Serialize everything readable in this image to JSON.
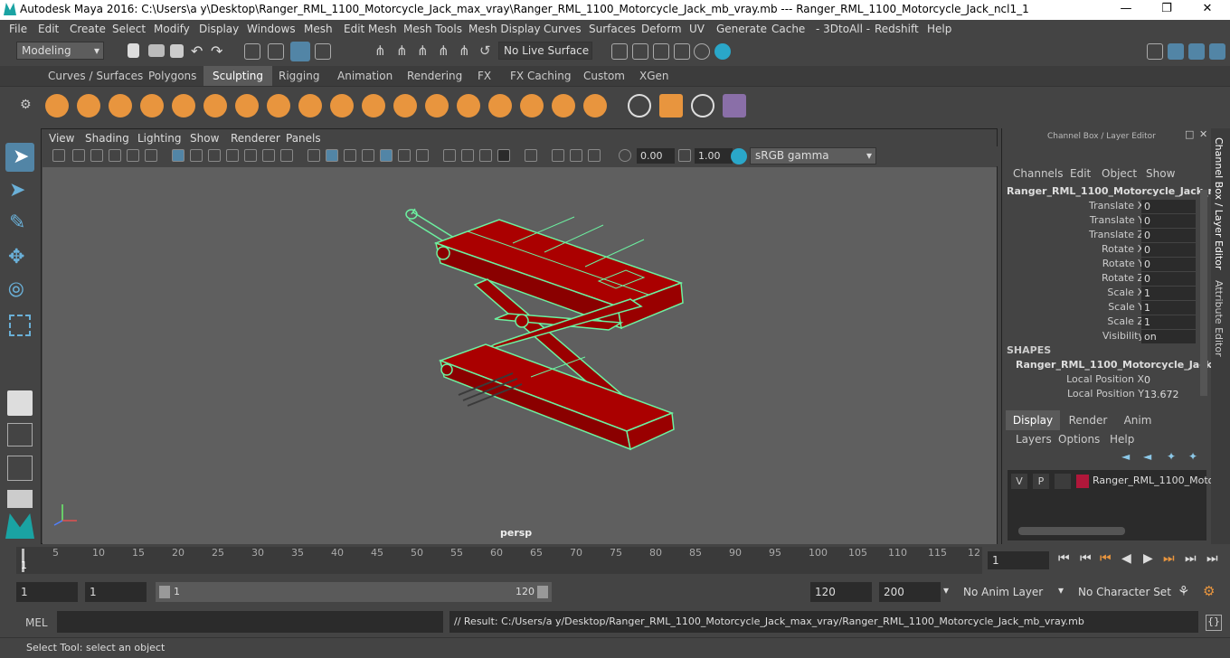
{
  "window": {
    "title": "Autodesk Maya 2016: C:\\Users\\a y\\Desktop\\Ranger_RML_1100_Motorcycle_Jack_max_vray\\Ranger_RML_1100_Motorcycle_Jack_mb_vray.mb   ---   Ranger_RML_1100_Motorcycle_Jack_ncl1_1",
    "minimize": "—",
    "maximize": "❐",
    "close": "✕"
  },
  "menu": [
    "File",
    "Edit",
    "Create",
    "Select",
    "Modify",
    "Display",
    "Windows",
    "Mesh",
    "Edit Mesh",
    "Mesh Tools",
    "Mesh Display",
    "Curves",
    "Surfaces",
    "Deform",
    "UV",
    "Generate",
    "Cache",
    "- 3DtoAll -",
    "Redshift",
    "Help"
  ],
  "statusline": {
    "mode": "Modeling",
    "live_surface": "No Live Surface"
  },
  "shelf_tabs": [
    {
      "label": "Curves / Surfaces",
      "active": false
    },
    {
      "label": "Polygons",
      "active": false
    },
    {
      "label": "Sculpting",
      "active": true
    },
    {
      "label": "Rigging",
      "active": false
    },
    {
      "label": "Animation",
      "active": false
    },
    {
      "label": "Rendering",
      "active": false
    },
    {
      "label": "FX",
      "active": false
    },
    {
      "label": "FX Caching",
      "active": false
    },
    {
      "label": "Custom",
      "active": false
    },
    {
      "label": "XGen",
      "active": false
    }
  ],
  "viewport": {
    "menu": [
      "View",
      "Shading",
      "Lighting",
      "Show",
      "Renderer",
      "Panels"
    ],
    "exposure": "0.00",
    "gamma": "1.00",
    "colorspace": "sRGB gamma",
    "camera_label": "persp"
  },
  "channel_box": {
    "header": "Channel Box / Layer Editor",
    "menu": [
      "Channels",
      "Edit",
      "Object",
      "Show"
    ],
    "object_name": "Ranger_RML_1100_Motorcycle_Jack_n...",
    "channels": [
      {
        "label": "Translate X",
        "value": "0"
      },
      {
        "label": "Translate Y",
        "value": "0"
      },
      {
        "label": "Translate Z",
        "value": "0"
      },
      {
        "label": "Rotate X",
        "value": "0"
      },
      {
        "label": "Rotate Y",
        "value": "0"
      },
      {
        "label": "Rotate Z",
        "value": "0"
      },
      {
        "label": "Scale X",
        "value": "1"
      },
      {
        "label": "Scale Y",
        "value": "1"
      },
      {
        "label": "Scale Z",
        "value": "1"
      },
      {
        "label": "Visibility",
        "value": "on"
      }
    ],
    "shapes_header": "SHAPES",
    "shape_name": "Ranger_RML_1100_Motorcycle_Jack...",
    "shape_channels": [
      {
        "label": "Local Position X",
        "value": "0"
      },
      {
        "label": "Local Position Y",
        "value": "13.672"
      }
    ]
  },
  "layer_editor": {
    "tabs": [
      "Display",
      "Render",
      "Anim"
    ],
    "menu": [
      "Layers",
      "Options",
      "Help"
    ],
    "layer": {
      "v": "V",
      "p": "P",
      "name": "Ranger_RML_1100_Moto",
      "color": "#b0173a"
    }
  },
  "side_tabs": [
    "Channel Box / Layer Editor",
    "Attribute Editor"
  ],
  "timeline": {
    "ticks": [
      "5",
      "10",
      "15",
      "20",
      "25",
      "30",
      "35",
      "40",
      "45",
      "50",
      "55",
      "60",
      "65",
      "70",
      "75",
      "80",
      "85",
      "90",
      "95",
      "100",
      "105",
      "110",
      "115",
      "12"
    ],
    "start_marker": "1",
    "current_frame": "1"
  },
  "range": {
    "start": "1",
    "playback_start": "1",
    "slider_start": "1",
    "slider_end": "120",
    "playback_end": "120",
    "end": "200",
    "anim_layer": "No Anim Layer",
    "char_set": "No Character Set"
  },
  "command": {
    "label": "MEL",
    "result": "// Result: C:/Users/a y/Desktop/Ranger_RML_1100_Motorcycle_Jack_max_vray/Ranger_RML_1100_Motorcycle_Jack_mb_vray.mb"
  },
  "help_line": "Select Tool: select an object",
  "colors": {
    "accent": "#5285a6",
    "model_fill": "#aa0000",
    "wire": "#6cf0a0",
    "shelf_icon": "#e8953e"
  }
}
